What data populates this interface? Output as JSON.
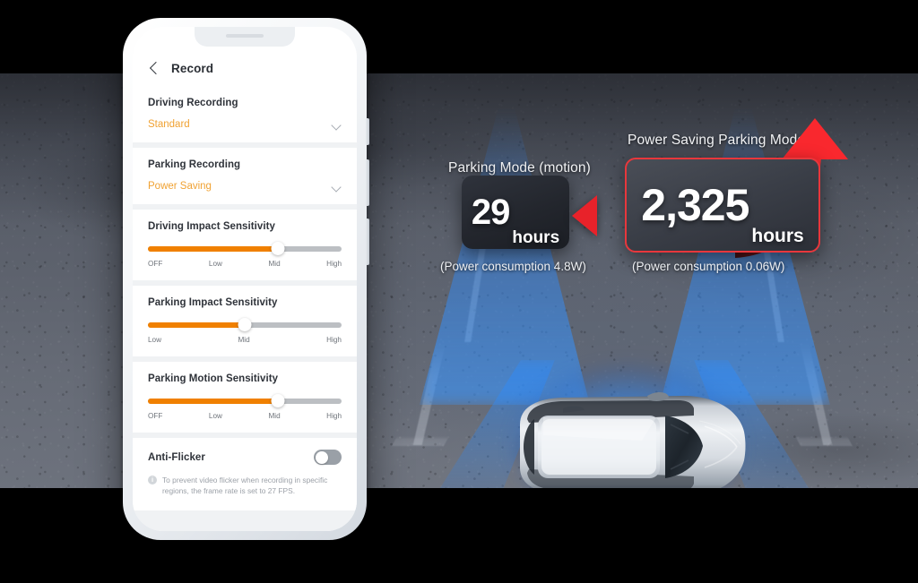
{
  "phone": {
    "appbar": {
      "back_icon": "chevron-left-icon",
      "title": "Record"
    },
    "sections": {
      "driving_recording": {
        "label": "Driving Recording",
        "value": "Standard",
        "chevron_icon": "chevron-down-icon"
      },
      "parking_recording": {
        "label": "Parking Recording",
        "value": "Power Saving",
        "chevron_icon": "chevron-down-icon"
      },
      "driving_impact_sensitivity": {
        "label": "Driving Impact Sensitivity",
        "percent": 67,
        "ticks": [
          "OFF",
          "Low",
          "Mid",
          "High"
        ]
      },
      "parking_impact_sensitivity": {
        "label": "Parking Impact Sensitivity",
        "percent": 50,
        "ticks": [
          "Low",
          "Mid",
          "High"
        ]
      },
      "parking_motion_sensitivity": {
        "label": "Parking Motion Sensitivity",
        "percent": 67,
        "ticks": [
          "OFF",
          "Low",
          "Mid",
          "High"
        ]
      },
      "anti_flicker": {
        "label": "Anti-Flicker",
        "toggle_state": "off",
        "info_icon": "info-icon",
        "note": "To prevent video flicker when recording in specific regions, the frame rate is set to 27 FPS."
      }
    }
  },
  "overlay": {
    "motion_mode": {
      "title": "Parking Mode (motion)",
      "number": "29",
      "unit": "hours",
      "power": "(Power consumption  4.8W)"
    },
    "power_saving_mode": {
      "title": "Power Saving Parking Mode",
      "number": "2,325",
      "unit": "hours",
      "power": "(Power consumption  0.06W)"
    },
    "arrow_left_icon": "arrow-left-triangle-icon",
    "arrow_curve_icon": "curved-up-arrow-icon",
    "accent_red": "#e8373c",
    "accent_orange": "#f08000",
    "glow_blue": "#3a96ff"
  },
  "scene": {
    "car_icon": "car-top-view-icon",
    "light_cone_icon": "light-cone-icon",
    "parking_line_icon": "parking-stall-line-icon"
  }
}
